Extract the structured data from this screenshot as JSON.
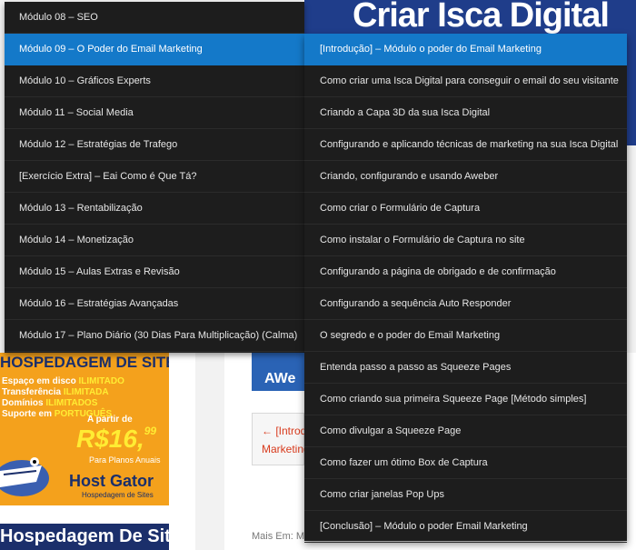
{
  "background": {
    "banner_title": "Criar Isca Digital",
    "hostgator": {
      "title": "HOSPEDAGEM DE SITES",
      "lines": [
        {
          "pre": "Espaço em disco ",
          "hl": "ILIMITADO"
        },
        {
          "pre": "Transferência ",
          "hl": "ILIMITADA"
        },
        {
          "pre": "Domínios ",
          "hl": "ILIMITADOS"
        },
        {
          "pre": "Suporte em ",
          "hl": "PORTUGUÊS"
        }
      ],
      "a_partir": "A partir de",
      "price": "R$16,",
      "cents": "99",
      "plan_note": "Para Planos Anuais",
      "brand": "Host Gator",
      "brand_sub": "Hospedagem de Sites",
      "band": "Hospedagem De Sites"
    },
    "aweber": "AWe",
    "prev_nav": [
      "← [Introd",
      "Marketing"
    ],
    "mais_em": "Mais Em: Mo"
  },
  "menu": {
    "modules": [
      {
        "label": "Módulo 08 – SEO",
        "active": false
      },
      {
        "label": "Módulo 09 – O Poder do Email Marketing",
        "active": true
      },
      {
        "label": "Módulo 10 – Gráficos Experts",
        "active": false
      },
      {
        "label": "Módulo 11 – Social Media",
        "active": false
      },
      {
        "label": "Módulo 12 – Estratégias de Trafego",
        "active": false
      },
      {
        "label": "[Exercício Extra] – Eai Como é Que Tá?",
        "active": false
      },
      {
        "label": "Módulo 13 – Rentabilização",
        "active": false
      },
      {
        "label": "Módulo 14 – Monetização",
        "active": false
      },
      {
        "label": "Módulo 15 – Aulas Extras e Revisão",
        "active": false
      },
      {
        "label": "Módulo 16 – Estratégias Avançadas",
        "active": false
      },
      {
        "label": "Módulo 17 – Plano Diário (30 Dias Para Multiplicação) (Calma)",
        "active": false
      }
    ],
    "lessons": [
      {
        "label": "[Introdução] – Módulo o poder do Email Marketing",
        "active": true
      },
      {
        "label": "Como criar uma Isca Digital para conseguir o email do seu visitante",
        "active": false
      },
      {
        "label": "Criando a Capa 3D da sua Isca Digital",
        "active": false
      },
      {
        "label": "Configurando e aplicando técnicas de marketing na sua Isca Digital",
        "active": false
      },
      {
        "label": "Criando, configurando e usando Aweber",
        "active": false
      },
      {
        "label": "Como criar o Formulário de Captura",
        "active": false
      },
      {
        "label": "Como instalar o Formulário de Captura no site",
        "active": false
      },
      {
        "label": "Configurando a página de obrigado e de confirmação",
        "active": false
      },
      {
        "label": "Configurando a sequência Auto Responder",
        "active": false
      },
      {
        "label": "O segredo e o poder do Email Marketing",
        "active": false
      },
      {
        "label": "Entenda passo a passo as Squeeze Pages",
        "active": false
      },
      {
        "label": "Como criando sua primeira Squeeze Page [Método simples]",
        "active": false
      },
      {
        "label": "Como divulgar a Squeeze Page",
        "active": false
      },
      {
        "label": "Como fazer um ótimo Box de Captura",
        "active": false
      },
      {
        "label": "Como criar janelas Pop Ups",
        "active": false
      },
      {
        "label": "[Conclusão] – Módulo o poder Email Marketing",
        "active": false
      }
    ]
  },
  "colors": {
    "menu_bg": "#1d1d1d",
    "active_bg": "#1479c9",
    "banner_blue": "#1f3d8a",
    "hostgator_orange": "#f4a11c"
  }
}
